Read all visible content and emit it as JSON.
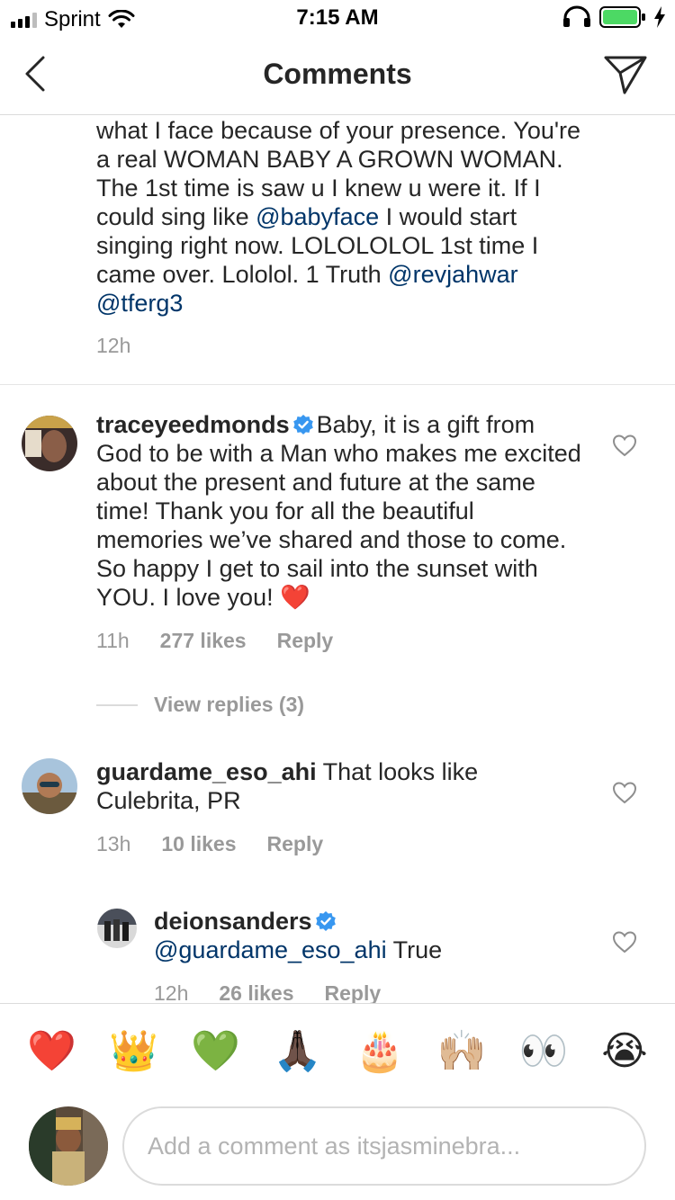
{
  "status_bar": {
    "carrier": "Sprint",
    "time": "7:15 AM"
  },
  "nav": {
    "title": "Comments"
  },
  "comments": [
    {
      "id": "partial",
      "lines_prefix": "what I face because of your presence. You're a real WOMAN BABY A GROWN WOMAN. The 1st time is saw u I knew u were it. If I could sing like ",
      "mention1": "@babyface",
      "lines_mid": " I would start singing right now. LOLOLOLOL 1st time I came over. Lololol. 1 Truth ",
      "mention2": "@revjahwar",
      "mention3": "@tferg3",
      "time": "12h"
    },
    {
      "id": "tracey",
      "username": "traceyeedmonds",
      "verified": true,
      "text": "Baby, it is a gift from God to be with a Man who makes me excited about the present and future at the same time! Thank you for all the beautiful memories we’ve shared and those to come. So happy I get to sail into the sunset with YOU. I love you! ",
      "text_emoji": "❤️",
      "time": "11h",
      "likes": "277 likes",
      "reply": "Reply",
      "view_replies": "View replies (3)"
    },
    {
      "id": "guardame",
      "username": "guardame_eso_ahi",
      "text": "That looks like Culebrita, PR",
      "time": "13h",
      "likes": "10 likes",
      "reply": "Reply"
    },
    {
      "id": "deion",
      "username": "deionsanders",
      "verified": true,
      "mention": "@guardame_eso_ahi",
      "text": " True",
      "time": "12h",
      "likes": "26 likes",
      "reply": "Reply"
    }
  ],
  "emoji_bar": [
    "❤️",
    "👑",
    "💚",
    "🙏🏿",
    "🎂",
    "🙌🏼",
    "👀",
    "😭"
  ],
  "composer": {
    "placeholder": "Add a comment as itsjasminebra..."
  },
  "colors": {
    "mention": "#003569",
    "meta": "#999999",
    "verified": "#3897f0",
    "battery": "#4cd964"
  }
}
